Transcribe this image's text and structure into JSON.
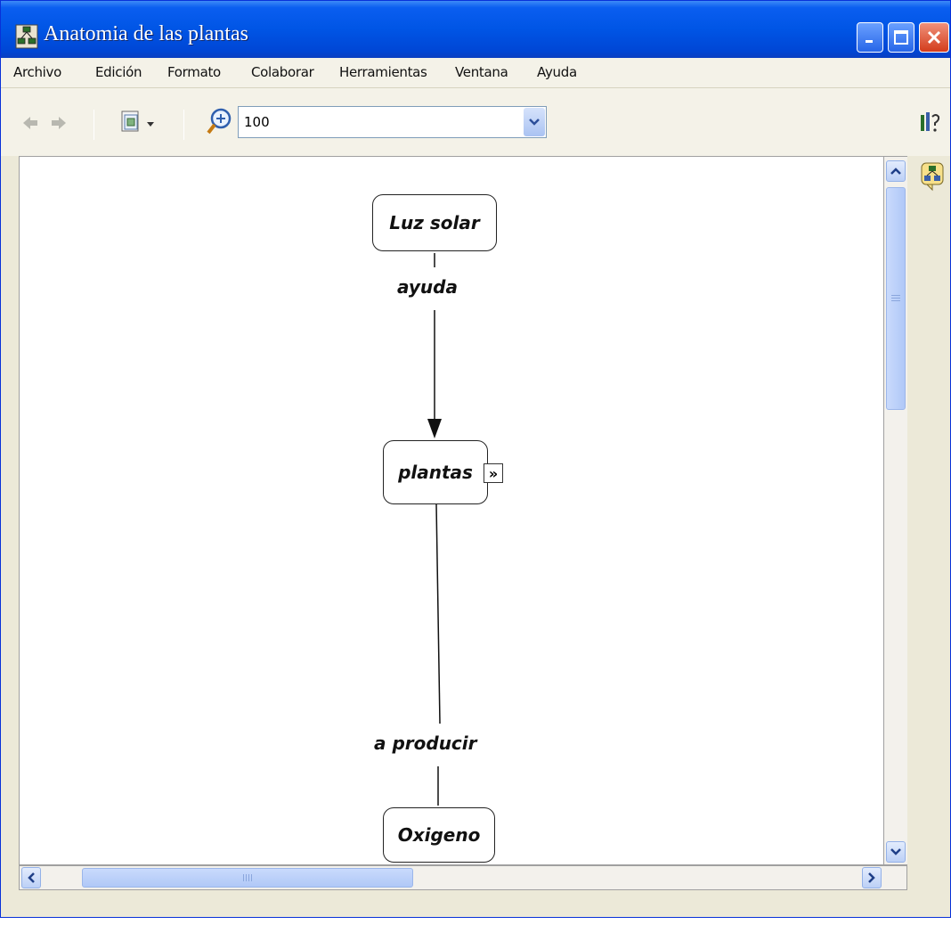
{
  "window": {
    "title": "Anatomia de las plantas",
    "title_icon": "cmap-app-icon"
  },
  "menu": {
    "items": [
      "Archivo",
      "Edición",
      "Formato",
      "Colaborar",
      "Herramientas",
      "Ventana",
      "Ayuda"
    ]
  },
  "toolbar": {
    "back_icon": "back-arrow-icon",
    "forward_icon": "forward-arrow-icon",
    "view_icon": "view-dropdown-icon",
    "zoom_icon": "zoom-in-icon",
    "zoom_value": "100"
  },
  "concept_map": {
    "concepts": [
      {
        "id": "luz",
        "label": "Luz solar"
      },
      {
        "id": "plantas",
        "label": "plantas",
        "has_expand": true
      },
      {
        "id": "oxigeno",
        "label": "Oxigeno"
      }
    ],
    "links": [
      {
        "label": "ayuda",
        "from": "luz",
        "to": "plantas",
        "arrow": true
      },
      {
        "label": "a producir",
        "from": "plantas",
        "to": "oxigeno",
        "arrow": false
      }
    ]
  },
  "side_panel": {
    "top_icon": "properties-icon",
    "second_icon": "concept-map-icon"
  },
  "colors": {
    "titlebar": "#0055e5",
    "chrome": "#f4f2e8",
    "close_button": "#d33c1c"
  }
}
